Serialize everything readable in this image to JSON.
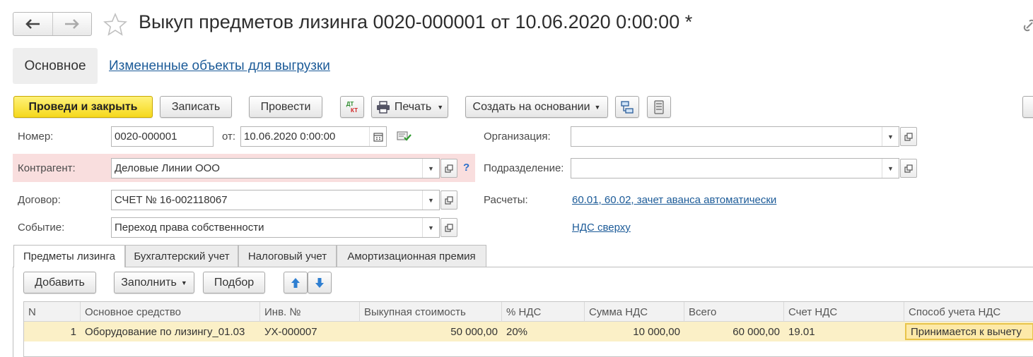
{
  "header": {
    "title": "Выкуп предметов лизинга 0020-000001 от 10.06.2020 0:00:00 *"
  },
  "nav_tabs": {
    "main": "Основное",
    "changed_objects": "Измененные объекты для выгрузки"
  },
  "toolbar": {
    "post_and_close": "Проведи и закрыть",
    "save": "Записать",
    "post": "Провести",
    "dt_kt_top": "ДТ",
    "dt_kt_bottom": "КТ",
    "print": "Печать",
    "create_based_on": "Создать на основании"
  },
  "form": {
    "number_label": "Номер:",
    "number_value": "0020-000001",
    "date_label": "от:",
    "date_value": "10.06.2020  0:00:00",
    "org_label": "Организация:",
    "org_value": "",
    "counterparty_label": "Контрагент:",
    "counterparty_value": "Деловые Линии ООО",
    "help_mark": "?",
    "division_label": "Подразделение:",
    "division_value": "",
    "contract_label": "Договор:",
    "contract_value": "СЧЕТ № 16-002118067",
    "settlements_label": "Расчеты:",
    "settlements_value": "60.01, 60.02, зачет аванса автоматически",
    "event_label": "Событие:",
    "event_value": "Переход права собственности",
    "vat_link": "НДС сверху"
  },
  "tabs": [
    {
      "label": "Предметы лизинга"
    },
    {
      "label": "Бухгалтерский учет"
    },
    {
      "label": "Налоговый учет"
    },
    {
      "label": "Амортизационная премия"
    }
  ],
  "table_toolbar": {
    "add": "Добавить",
    "fill": "Заполнить",
    "selection": "Подбор"
  },
  "table": {
    "columns": [
      "N",
      "Основное средство",
      "Инв. №",
      "Выкупная стоимость",
      "% НДС",
      "Сумма НДС",
      "Всего",
      "Счет НДС",
      "Способ учета НДС"
    ],
    "rows": [
      [
        "1",
        "Оборудование по лизингу_01.03",
        "УХ-000007",
        "50 000,00",
        "20%",
        "10 000,00",
        "60 000,00",
        "19.01",
        "Принимается к вычету"
      ]
    ]
  },
  "colors": {
    "primary_button": "#f5d81c",
    "link": "#1c5b98",
    "highlight_row": "#fbf0c7",
    "error_field_bg": "#f9dede"
  }
}
